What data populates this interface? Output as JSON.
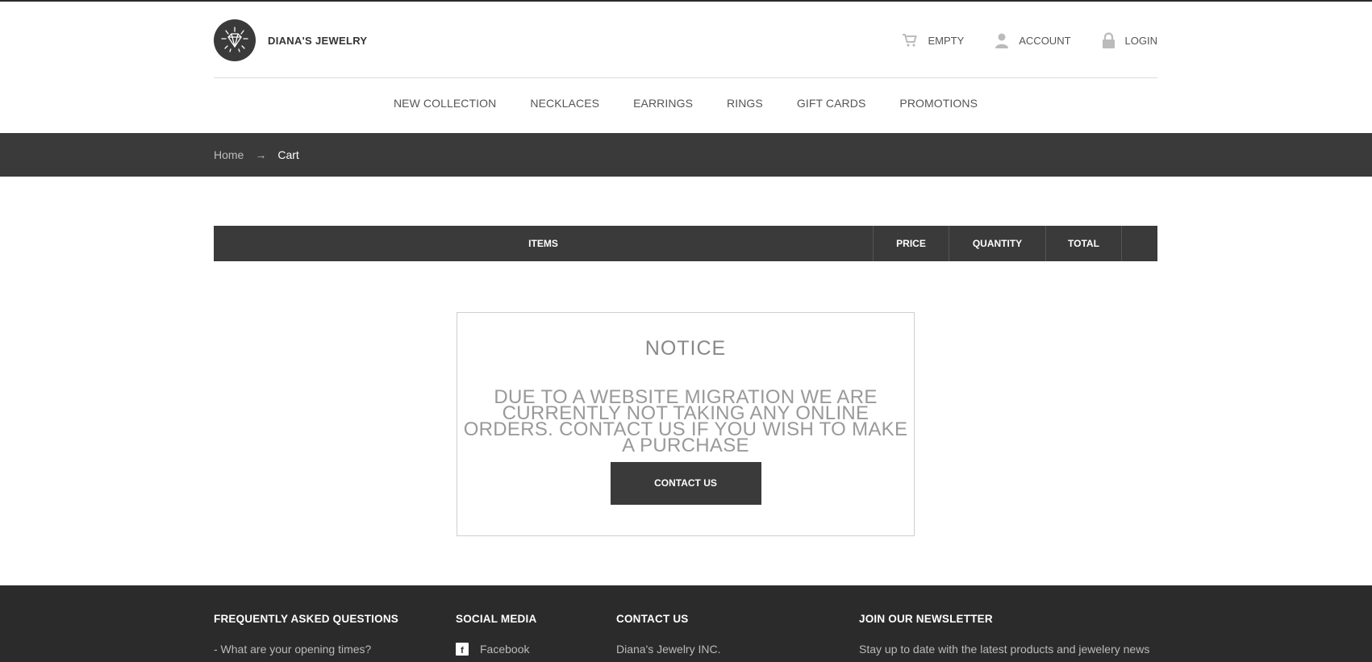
{
  "brand": {
    "name": "DIANA'S JEWELRY"
  },
  "top_links": {
    "cart": "EMPTY",
    "account": "ACCOUNT",
    "login": "LOGIN"
  },
  "nav": {
    "items": [
      "NEW COLLECTION",
      "NECKLACES",
      "EARRINGS",
      "RINGS",
      "GIFT CARDS",
      "PROMOTIONS"
    ]
  },
  "breadcrumb": {
    "home": "Home",
    "separator": "→",
    "current": "Cart"
  },
  "cart_table": {
    "headers": [
      "ITEMS",
      "PRICE",
      "QUANTITY",
      "TOTAL",
      ""
    ]
  },
  "notice": {
    "title": "NOTICE",
    "message": "DUE TO A WEBSITE MIGRATION WE ARE CURRENTLY NOT TAKING ANY ONLINE ORDERS. CONTACT US IF YOU WISH TO MAKE A PURCHASE",
    "button": "CONTACT US"
  },
  "footer": {
    "faq": {
      "heading": "FREQUENTLY ASKED QUESTIONS",
      "item": "- What are your opening times?"
    },
    "social": {
      "heading": "SOCIAL MEDIA",
      "item": "Facebook"
    },
    "contact": {
      "heading": "CONTACT US",
      "item": "Diana's Jewelry INC."
    },
    "newsletter": {
      "heading": "JOIN OUR NEWSLETTER",
      "item": "Stay up to date with the latest products and jewelery news"
    }
  },
  "colors": {
    "dark_band": "#3a3a3a",
    "footer_bg": "#2b2b2b",
    "nav_text": "#555555"
  }
}
